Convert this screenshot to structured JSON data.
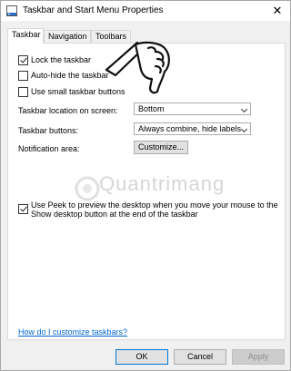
{
  "window": {
    "title": "Taskbar and Start Menu Properties",
    "close_glyph": "✕"
  },
  "tabs": [
    {
      "label": "Taskbar",
      "active": true
    },
    {
      "label": "Navigation",
      "active": false
    },
    {
      "label": "Toolbars",
      "active": false
    }
  ],
  "options": {
    "lock_taskbar": {
      "label": "Lock the taskbar",
      "checked": true
    },
    "auto_hide": {
      "label": "Auto-hide the taskbar",
      "checked": false
    },
    "small_buttons": {
      "label": "Use small taskbar buttons",
      "checked": false
    }
  },
  "location": {
    "label": "Taskbar location on screen:",
    "value": "Bottom"
  },
  "buttons_setting": {
    "label": "Taskbar buttons:",
    "value": "Always combine, hide labels"
  },
  "notification": {
    "label": "Notification area:",
    "button": "Customize..."
  },
  "peek": {
    "label": "Use Peek to preview the desktop when you move your mouse to the Show desktop button at the end of the taskbar",
    "checked": true
  },
  "help_link": "How do I customize taskbars?",
  "dialog_buttons": {
    "ok": "OK",
    "cancel": "Cancel",
    "apply": "Apply"
  },
  "watermark": {
    "text": "Quantrimang",
    "icon": "thumbs-down-hand-icon"
  },
  "colors": {
    "link": "#0066cc",
    "accent": "#0078d7",
    "window_bg": "#f0f0f0"
  }
}
